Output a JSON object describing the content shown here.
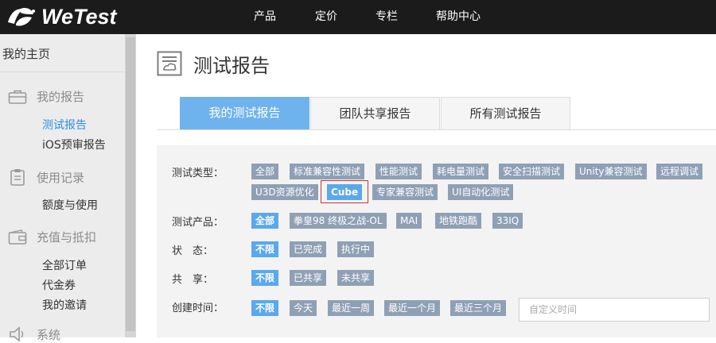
{
  "brand": {
    "name": "WeTest"
  },
  "nav": [
    "产品",
    "定价",
    "专栏",
    "帮助中心"
  ],
  "sidebar": {
    "home": "我的主页",
    "sections": [
      {
        "label": "我的报告",
        "icon": "briefcase-icon",
        "items": [
          "测试报告",
          "iOS预审报告"
        ],
        "active_item": 0
      },
      {
        "label": "使用记录",
        "icon": "clipboard-icon",
        "items": [
          "额度与使用"
        ]
      },
      {
        "label": "充值与抵扣",
        "icon": "wallet-icon",
        "items": [
          "全部订单",
          "代金券",
          "我的邀请"
        ]
      },
      {
        "label": "系统",
        "icon": "speaker-icon",
        "items": []
      }
    ]
  },
  "page": {
    "title": "测试报告"
  },
  "tabs": [
    {
      "label": "我的测试报告",
      "active": true
    },
    {
      "label": "团队共享报告",
      "active": false
    },
    {
      "label": "所有测试报告",
      "active": false
    }
  ],
  "filters": {
    "type": {
      "label": "测试类型：",
      "row1": [
        "全部",
        "标准兼容性测试",
        "性能测试",
        "耗电量测试",
        "安全扫描测试",
        "Unity兼容测试",
        "远程调试"
      ],
      "row2": [
        "U3D资源优化",
        "Cube",
        "专家兼容测试",
        "UI自动化测试"
      ],
      "selected": "Cube"
    },
    "product": {
      "label": "测试产品：",
      "options": [
        "全部",
        "拳皇98 终极之战-OL",
        "MAI",
        "地铁跑酷",
        "33IQ"
      ],
      "selected": "全部"
    },
    "status": {
      "label": "状　态：",
      "options": [
        "不限",
        "已完成",
        "执行中"
      ],
      "selected": "不限"
    },
    "share": {
      "label": "共　享：",
      "options": [
        "不限",
        "已共享",
        "未共享"
      ],
      "selected": "不限"
    },
    "created": {
      "label": "创建时间：",
      "options": [
        "不限",
        "今天",
        "最近一周",
        "最近一个月",
        "最近三个月"
      ],
      "selected": "不限",
      "custom_placeholder": "自定义时间"
    }
  },
  "colors": {
    "topbar": "#1b1b1b",
    "accent": "#6fb3ee",
    "tag": "#8fa0b5",
    "tag_selected": "#5aa8ee",
    "link_active": "#2d8ee4"
  }
}
